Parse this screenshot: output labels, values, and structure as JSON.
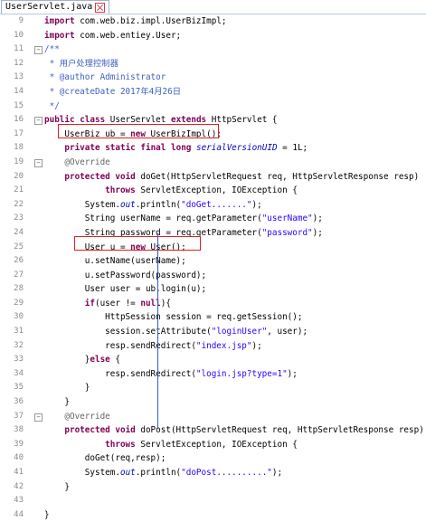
{
  "tab": {
    "title": "UserServlet.java"
  },
  "lines": [
    {
      "n": "9",
      "fold": "",
      "html": "<span class=\"kw\">import</span> com.web.biz.impl.UserBizImpl;"
    },
    {
      "n": "10",
      "fold": "",
      "html": "<span class=\"kw\">import</span> com.web.entiey.User;"
    },
    {
      "n": "11",
      "fold": "-",
      "html": "<span class=\"jd\">/**</span>"
    },
    {
      "n": "12",
      "fold": "",
      "html": "<span class=\"jd\"> * 用户处理控制器</span>"
    },
    {
      "n": "13",
      "fold": "",
      "html": "<span class=\"jd\"> * @author Administrator</span>"
    },
    {
      "n": "14",
      "fold": "",
      "html": "<span class=\"jd\"> * @createDate 2017年4月26日</span>"
    },
    {
      "n": "15",
      "fold": "",
      "html": "<span class=\"jd\"> */</span>"
    },
    {
      "n": "16",
      "fold": "-",
      "html": "<span class=\"kw\">public</span> <span class=\"kw\">class</span> UserServlet <span class=\"kw\">extends</span> HttpServlet {"
    },
    {
      "n": "17",
      "fold": "",
      "html": "    UserBiz ub = <span class=\"kw\">new</span> UserBizImpl();"
    },
    {
      "n": "18",
      "fold": "",
      "html": "    <span class=\"kw\">private</span> <span class=\"kw\">static</span> <span class=\"kw\">final</span> <span class=\"kw\">long</span> <span class=\"fld\">serialVersionUID</span> = 1L;"
    },
    {
      "n": "19",
      "fold": "-",
      "html": "    <span class=\"an\">@Override</span>"
    },
    {
      "n": "20",
      "fold": "",
      "html": "    <span class=\"kw\">protected</span> <span class=\"kw\">void</span> doGet(HttpServletRequest req, HttpServletResponse resp)"
    },
    {
      "n": "21",
      "fold": "",
      "html": "            <span class=\"kw\">throws</span> ServletException, IOException {"
    },
    {
      "n": "22",
      "fold": "",
      "html": "        System.<span class=\"fld\">out</span>.println(<span class=\"str\">\"doGet.......\"</span>);"
    },
    {
      "n": "23",
      "fold": "",
      "html": "        String userName = req.getParameter(<span class=\"str\">\"userName\"</span>);"
    },
    {
      "n": "24",
      "fold": "",
      "html": "        String password = req.getParameter(<span class=\"str\">\"password\"</span>);"
    },
    {
      "n": "25",
      "fold": "",
      "html": "        User u = <span class=\"kw\">new</span> User();"
    },
    {
      "n": "26",
      "fold": "",
      "html": "        u.setName(userName);"
    },
    {
      "n": "27",
      "fold": "",
      "html": "        u.setPassword(password);"
    },
    {
      "n": "28",
      "fold": "",
      "html": "        User user = ub.login(u);"
    },
    {
      "n": "29",
      "fold": "",
      "html": "        <span class=\"kw\">if</span>(user != <span class=\"kw\">null</span>){"
    },
    {
      "n": "30",
      "fold": "",
      "html": "            HttpSession session = req.getSession();"
    },
    {
      "n": "31",
      "fold": "",
      "html": "            session.setAttribute(<span class=\"str\">\"loginUser\"</span>, user);"
    },
    {
      "n": "32",
      "fold": "",
      "html": "            resp.sendRedirect(<span class=\"str\">\"index.jsp\"</span>);"
    },
    {
      "n": "33",
      "fold": "",
      "html": "        }<span class=\"kw\">else</span> {"
    },
    {
      "n": "34",
      "fold": "",
      "html": "            resp.sendRedirect(<span class=\"str\">\"login.jsp?type=1\"</span>);"
    },
    {
      "n": "35",
      "fold": "",
      "html": "        }"
    },
    {
      "n": "36",
      "fold": "",
      "html": "    }"
    },
    {
      "n": "37",
      "fold": "-",
      "html": "    <span class=\"an\">@Override</span>"
    },
    {
      "n": "38",
      "fold": "",
      "html": "    <span class=\"kw\">protected</span> <span class=\"kw\">void</span> doPost(HttpServletRequest req, HttpServletResponse resp)"
    },
    {
      "n": "39",
      "fold": "",
      "html": "            <span class=\"kw\">throws</span> ServletException, IOException {"
    },
    {
      "n": "40",
      "fold": "",
      "html": "        doGet(req,resp);"
    },
    {
      "n": "41",
      "fold": "",
      "html": "        System.<span class=\"fld\">out</span>.println(<span class=\"str\">\"doPost..........\"</span>);"
    },
    {
      "n": "42",
      "fold": "",
      "html": "    }"
    },
    {
      "n": "43",
      "fold": "",
      "html": ""
    },
    {
      "n": "44",
      "fold": "",
      "html": "}"
    }
  ]
}
